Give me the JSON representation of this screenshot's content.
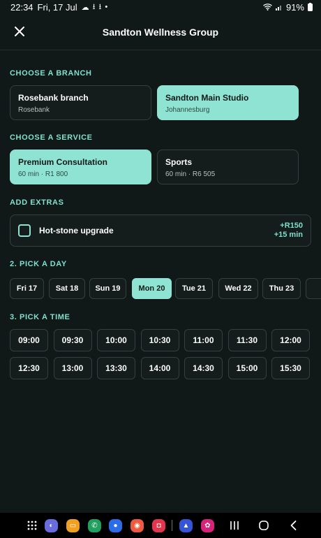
{
  "status": {
    "time": "22:34",
    "date": "Fri, 17 Jul",
    "battery": "91%"
  },
  "header": {
    "title": "Sandton Wellness Group"
  },
  "sections": {
    "branch": "CHOOSE A BRANCH",
    "service": "CHOOSE A SERVICE",
    "extras": "ADD EXTRAS",
    "day": "2. PICK A DAY",
    "time": "3. PICK A TIME"
  },
  "branches": [
    {
      "name": "Rosebank branch",
      "sub": "Rosebank",
      "selected": false
    },
    {
      "name": "Sandton Main Studio",
      "sub": "Johannesburg",
      "selected": true
    }
  ],
  "services": [
    {
      "name": "Premium Consultation",
      "sub": "60 min · R1 800",
      "selected": true
    },
    {
      "name": "Sports",
      "sub": "60 min · R6 505",
      "selected": false
    }
  ],
  "extra": {
    "label": "Hot-stone upgrade",
    "price": "+R150",
    "duration": "+15 min",
    "checked": false
  },
  "days": [
    {
      "label": "Fri 17",
      "selected": false
    },
    {
      "label": "Sat 18",
      "selected": false
    },
    {
      "label": "Sun 19",
      "selected": false
    },
    {
      "label": "Mon 20",
      "selected": true
    },
    {
      "label": "Tue 21",
      "selected": false
    },
    {
      "label": "Wed 22",
      "selected": false
    },
    {
      "label": "Thu 23",
      "selected": false
    }
  ],
  "times": [
    "09:00",
    "09:30",
    "10:00",
    "10:30",
    "11:00",
    "11:30",
    "12:00",
    "12:30",
    "13:00",
    "13:30",
    "14:00",
    "14:30",
    "15:00",
    "15:30"
  ],
  "colors": {
    "accent": "#8fe3d3",
    "accent_text": "#7fe0cd",
    "background": "#111818"
  },
  "icons": [
    "close-icon",
    "cloud-icon",
    "download-icon",
    "wifi-icon",
    "signal-icon",
    "battery-icon",
    "apps-grid-icon",
    "recents-icon",
    "home-icon",
    "back-icon"
  ]
}
